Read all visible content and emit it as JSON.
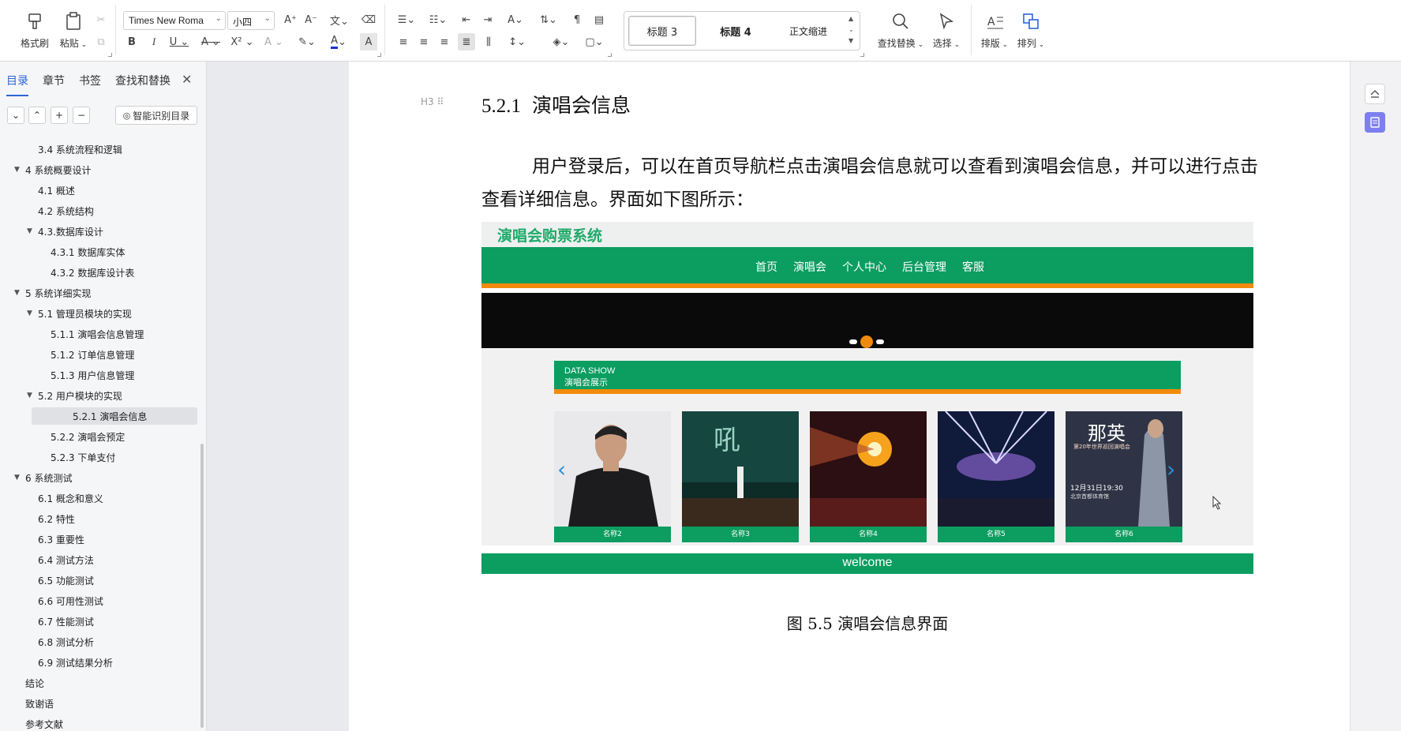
{
  "ribbon": {
    "format_painter": "格式刷",
    "paste": "粘贴",
    "font_name": "Times New Roma",
    "font_size": "小四",
    "styles": [
      "标题 3",
      "标题 4",
      "正文缩进"
    ],
    "find_replace": "查找替换",
    "select": "选择",
    "typesetting": "排版",
    "arrange": "排列"
  },
  "left_panel": {
    "tabs": [
      "目录",
      "章节",
      "书签",
      "查找和替换"
    ],
    "smart_toc": "智能识别目录",
    "toc": [
      {
        "label": "3.4 系统流程和逻辑",
        "level": 2,
        "toggle": ""
      },
      {
        "label": "4 系统概要设计",
        "level": 1,
        "toggle": "▼"
      },
      {
        "label": "4.1 概述",
        "level": 2,
        "toggle": ""
      },
      {
        "label": "4.2 系统结构",
        "level": 2,
        "toggle": ""
      },
      {
        "label": "4.3.数据库设计",
        "level": 2,
        "toggle": "▼"
      },
      {
        "label": "4.3.1 数据库实体",
        "level": 3,
        "toggle": ""
      },
      {
        "label": "4.3.2 数据库设计表",
        "level": 3,
        "toggle": ""
      },
      {
        "label": "5 系统详细实现",
        "level": 1,
        "toggle": "▼"
      },
      {
        "label": "5.1  管理员模块的实现",
        "level": 2,
        "toggle": "▼"
      },
      {
        "label": "5.1.1  演唱会信息管理",
        "level": 3,
        "toggle": ""
      },
      {
        "label": "5.1.2  订单信息管理",
        "level": 3,
        "toggle": ""
      },
      {
        "label": "5.1.3  用户信息管理",
        "level": 3,
        "toggle": ""
      },
      {
        "label": "5.2  用户模块的实现",
        "level": 2,
        "toggle": "▼"
      },
      {
        "label": "5.2.1  演唱会信息",
        "level": 3,
        "toggle": "",
        "selected": true
      },
      {
        "label": "5.2.2  演唱会预定",
        "level": 3,
        "toggle": ""
      },
      {
        "label": "5.2.3  下单支付",
        "level": 3,
        "toggle": ""
      },
      {
        "label": "6 系统测试",
        "level": 1,
        "toggle": "▼"
      },
      {
        "label": "6.1 概念和意义",
        "level": 2,
        "toggle": ""
      },
      {
        "label": "6.2 特性",
        "level": 2,
        "toggle": ""
      },
      {
        "label": "6.3 重要性",
        "level": 2,
        "toggle": ""
      },
      {
        "label": "6.4 测试方法",
        "level": 2,
        "toggle": ""
      },
      {
        "label": "6.5  功能测试",
        "level": 2,
        "toggle": ""
      },
      {
        "label": "6.6 可用性测试",
        "level": 2,
        "toggle": ""
      },
      {
        "label": "6.7 性能测试",
        "level": 2,
        "toggle": ""
      },
      {
        "label": "6.8 测试分析",
        "level": 2,
        "toggle": ""
      },
      {
        "label": "6.9 测试结果分析",
        "level": 2,
        "toggle": ""
      },
      {
        "label": "结论",
        "level": 1,
        "toggle": ""
      },
      {
        "label": "致谢语",
        "level": 1,
        "toggle": ""
      },
      {
        "label": "参考文献",
        "level": 1,
        "toggle": ""
      }
    ]
  },
  "document": {
    "heading_marker": "H3",
    "heading_num": "5.2.1",
    "heading_text": "演唱会信息",
    "paragraph": "用户登录后，可以在首页导航栏点击演唱会信息就可以查看到演唱会信息，并可以进行点击查看详细信息。界面如下图所示：",
    "caption": "图 5.5  演唱会信息界面"
  },
  "figure": {
    "site_title": "演唱会购票系统",
    "nav": [
      "首页",
      "演唱会",
      "个人中心",
      "后台管理",
      "客服"
    ],
    "datashow_en": "DATA SHOW",
    "datashow_cn": "演唱会展示",
    "cards": [
      "名称2",
      "名称3",
      "名称4",
      "名称5",
      "名称6"
    ],
    "poster_text": "那英",
    "poster_sub": "第20年世界巡回演唱会",
    "poster_date": "12月31日19:30",
    "poster_venue": "北京首都体育馆",
    "welcome": "welcome"
  },
  "colors": {
    "accent_blue": "#2f64d8",
    "site_green": "#0c9d61",
    "site_orange": "#f28b0b"
  }
}
